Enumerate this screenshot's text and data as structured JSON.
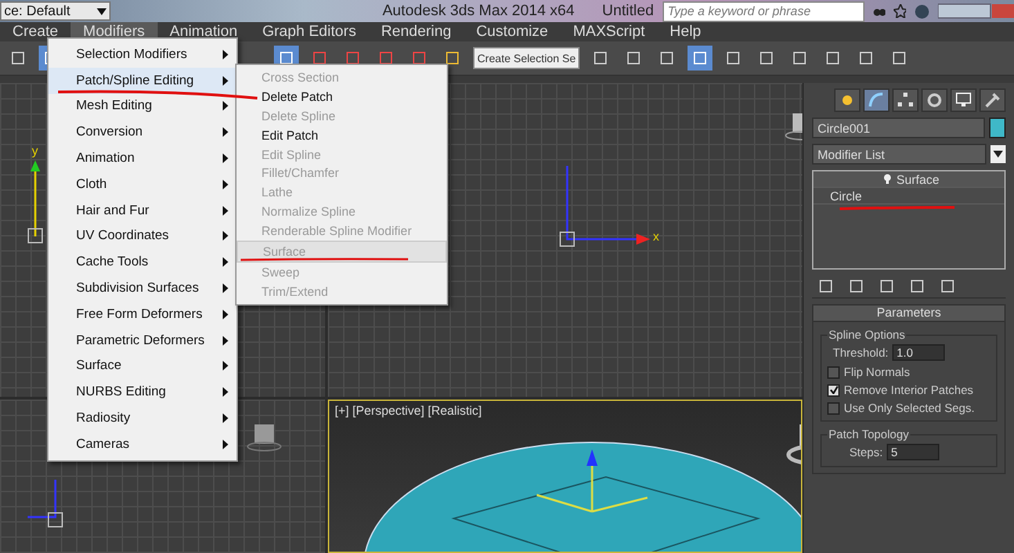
{
  "title_bar": {
    "workspace": "ce: Default",
    "app_title": "Autodesk 3ds Max  2014 x64",
    "document": "Untitled",
    "search": {
      "placeholder": "Type a keyword or phrase"
    }
  },
  "menu_bar": [
    {
      "label": "Create",
      "selected": false
    },
    {
      "label": "Modifiers",
      "selected": true
    },
    {
      "label": "Animation",
      "selected": false
    },
    {
      "label": "Graph Editors",
      "selected": false
    },
    {
      "label": "Rendering",
      "selected": false
    },
    {
      "label": "Customize",
      "selected": false
    },
    {
      "label": "MAXScript",
      "selected": false
    },
    {
      "label": "Help",
      "selected": false
    }
  ],
  "toolbar": {
    "selection_set": "Create Selection Se"
  },
  "modifiers_menu": [
    {
      "label": "Selection Modifiers",
      "selected": false
    },
    {
      "label": "Patch/Spline Editing",
      "selected": true
    },
    {
      "label": "Mesh Editing",
      "selected": false
    },
    {
      "label": "Conversion",
      "selected": false
    },
    {
      "label": "Animation",
      "selected": false
    },
    {
      "label": "Cloth",
      "selected": false
    },
    {
      "label": "Hair and Fur",
      "selected": false
    },
    {
      "label": "UV Coordinates",
      "selected": false
    },
    {
      "label": "Cache Tools",
      "selected": false
    },
    {
      "label": "Subdivision Surfaces",
      "selected": false
    },
    {
      "label": "Free Form Deformers",
      "selected": false
    },
    {
      "label": "Parametric Deformers",
      "selected": false
    },
    {
      "label": "Surface",
      "selected": false
    },
    {
      "label": "NURBS Editing",
      "selected": false
    },
    {
      "label": "Radiosity",
      "selected": false
    },
    {
      "label": "Cameras",
      "selected": false
    }
  ],
  "submenu": [
    {
      "label": "Cross Section",
      "disabled": true,
      "selected": false
    },
    {
      "label": "Delete Patch",
      "disabled": false,
      "selected": false
    },
    {
      "label": "Delete Spline",
      "disabled": true,
      "selected": false
    },
    {
      "label": "Edit Patch",
      "disabled": false,
      "selected": false
    },
    {
      "label": "Edit Spline",
      "disabled": true,
      "selected": false
    },
    {
      "label": "Fillet/Chamfer",
      "disabled": true,
      "selected": false
    },
    {
      "label": "Lathe",
      "disabled": true,
      "selected": false
    },
    {
      "label": "Normalize Spline",
      "disabled": true,
      "selected": false
    },
    {
      "label": "Renderable Spline Modifier",
      "disabled": true,
      "selected": false
    },
    {
      "label": "Surface",
      "disabled": true,
      "selected": true
    },
    {
      "label": "Sweep",
      "disabled": true,
      "selected": false
    },
    {
      "label": "Trim/Extend",
      "disabled": true,
      "selected": false
    }
  ],
  "viewports": {
    "top_left_axis": "y",
    "top_right_axis": "x",
    "perspective_label": "[+] [Perspective] [Realistic]"
  },
  "command_panel": {
    "tabs": [
      {
        "kind": "create",
        "selected": false
      },
      {
        "kind": "modify",
        "selected": true
      },
      {
        "kind": "hierarchy",
        "selected": false
      },
      {
        "kind": "motion",
        "selected": false
      },
      {
        "kind": "display",
        "selected": false
      },
      {
        "kind": "utilities",
        "selected": false
      }
    ],
    "object_name": "Circle001",
    "modifier_list": "Modifier List",
    "stack": [
      {
        "label": "Surface",
        "selected": true
      },
      {
        "label": "Circle",
        "selected": false
      }
    ],
    "parameters": {
      "title": "Parameters",
      "spline_options": {
        "title": "Spline Options",
        "threshold_label": "Threshold:",
        "threshold": "1.0",
        "options": [
          {
            "label": "Flip Normals",
            "checked": false
          },
          {
            "label": "Remove Interior Patches",
            "checked": true
          },
          {
            "label": "Use Only Selected Segs.",
            "checked": false
          }
        ]
      },
      "patch_topology": {
        "title": "Patch Topology",
        "steps_label": "Steps:",
        "steps": "5"
      }
    }
  }
}
